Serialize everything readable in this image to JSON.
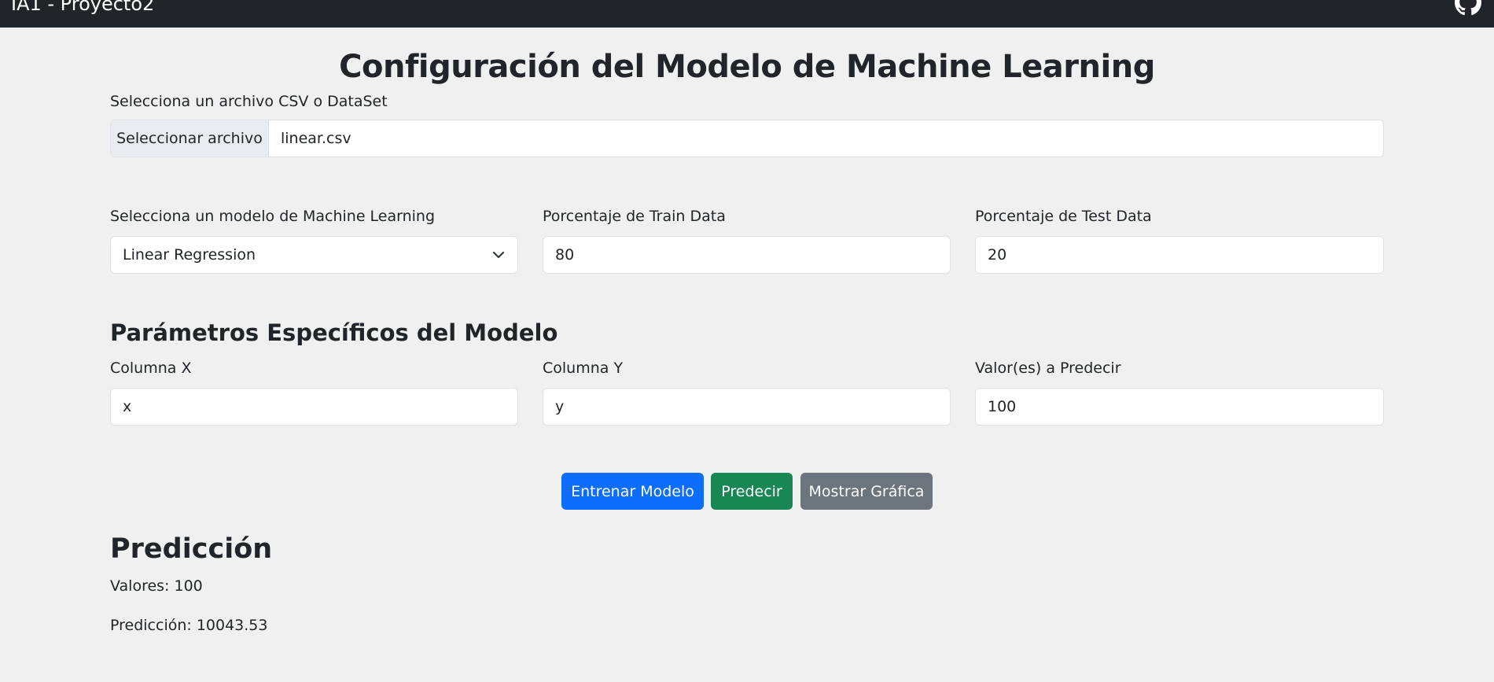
{
  "navbar": {
    "brand": "IA1 - Proyecto2",
    "icon": "github-icon",
    "background": "#212529"
  },
  "page": {
    "title": "Configuración del Modelo de Machine Learning",
    "background": "#f0f0f0"
  },
  "file": {
    "label": "Selecciona un archivo CSV o DataSet",
    "button_label": "Seleccionar archivo",
    "file_name": "linear.csv"
  },
  "model": {
    "label": "Selecciona un modelo de Machine Learning",
    "selected": "Linear Regression",
    "icon": "chevron-down-icon"
  },
  "train": {
    "label": "Porcentaje de Train Data",
    "value": "80"
  },
  "test": {
    "label": "Porcentaje de Test Data",
    "value": "20"
  },
  "params": {
    "title": "Parámetros Específicos del Modelo",
    "col_x_label": "Columna X",
    "col_x_value": "x",
    "col_y_label": "Columna Y",
    "col_y_value": "y",
    "predict_label": "Valor(es) a Predecir",
    "predict_value": "100"
  },
  "actions": {
    "train_label": "Entrenar Modelo",
    "train_color": "#0d6efd",
    "predict_label": "Predecir",
    "predict_color": "#198754",
    "chart_label": "Mostrar Gráfica",
    "chart_color": "#6c757d"
  },
  "prediction": {
    "title": "Predicción",
    "values_line": "Valores: 100",
    "result_line": "Predicción: 10043.53"
  }
}
